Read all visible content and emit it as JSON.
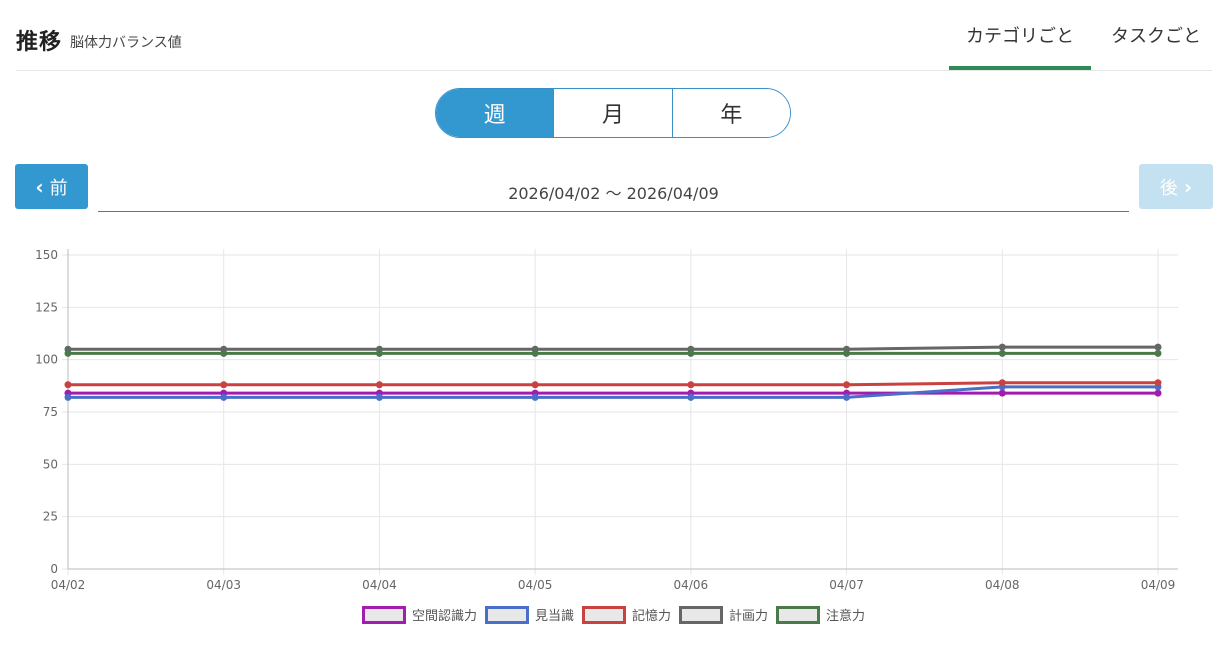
{
  "header": {
    "title": "推移",
    "subtitle": "脳体力バランス値",
    "tabs": [
      {
        "label": "カテゴリごと",
        "active": true
      },
      {
        "label": "タスクごと",
        "active": false
      }
    ]
  },
  "period": {
    "options": [
      {
        "label": "週",
        "active": true
      },
      {
        "label": "月",
        "active": false
      },
      {
        "label": "年",
        "active": false
      }
    ]
  },
  "nav": {
    "prev_label": "前",
    "next_label": "後",
    "range": "2026/04/02 〜 2026/04/09"
  },
  "colors": {
    "accent": "#3397d0",
    "tab_underline": "#2e8b57"
  },
  "chart_data": {
    "type": "line",
    "x": [
      "04/02",
      "04/03",
      "04/04",
      "04/05",
      "04/06",
      "04/07",
      "04/08",
      "04/09"
    ],
    "ylim": [
      0,
      150
    ],
    "yticks": [
      0,
      25,
      50,
      75,
      100,
      125,
      150
    ],
    "grid": true,
    "legend": "bottom",
    "series": [
      {
        "name": "空間認識力",
        "color": "#a21caf",
        "values": [
          84,
          84,
          84,
          84,
          84,
          84,
          84,
          84
        ]
      },
      {
        "name": "見当識",
        "color": "#4a6fc9",
        "values": [
          82,
          82,
          82,
          82,
          82,
          82,
          87,
          87
        ]
      },
      {
        "name": "記憶力",
        "color": "#c9423f",
        "values": [
          88,
          88,
          88,
          88,
          88,
          88,
          89,
          89
        ]
      },
      {
        "name": "計画力",
        "color": "#666666",
        "values": [
          105,
          105,
          105,
          105,
          105,
          105,
          106,
          106
        ]
      },
      {
        "name": "注意力",
        "color": "#4a7a4a",
        "values": [
          103,
          103,
          103,
          103,
          103,
          103,
          103,
          103
        ]
      }
    ]
  }
}
